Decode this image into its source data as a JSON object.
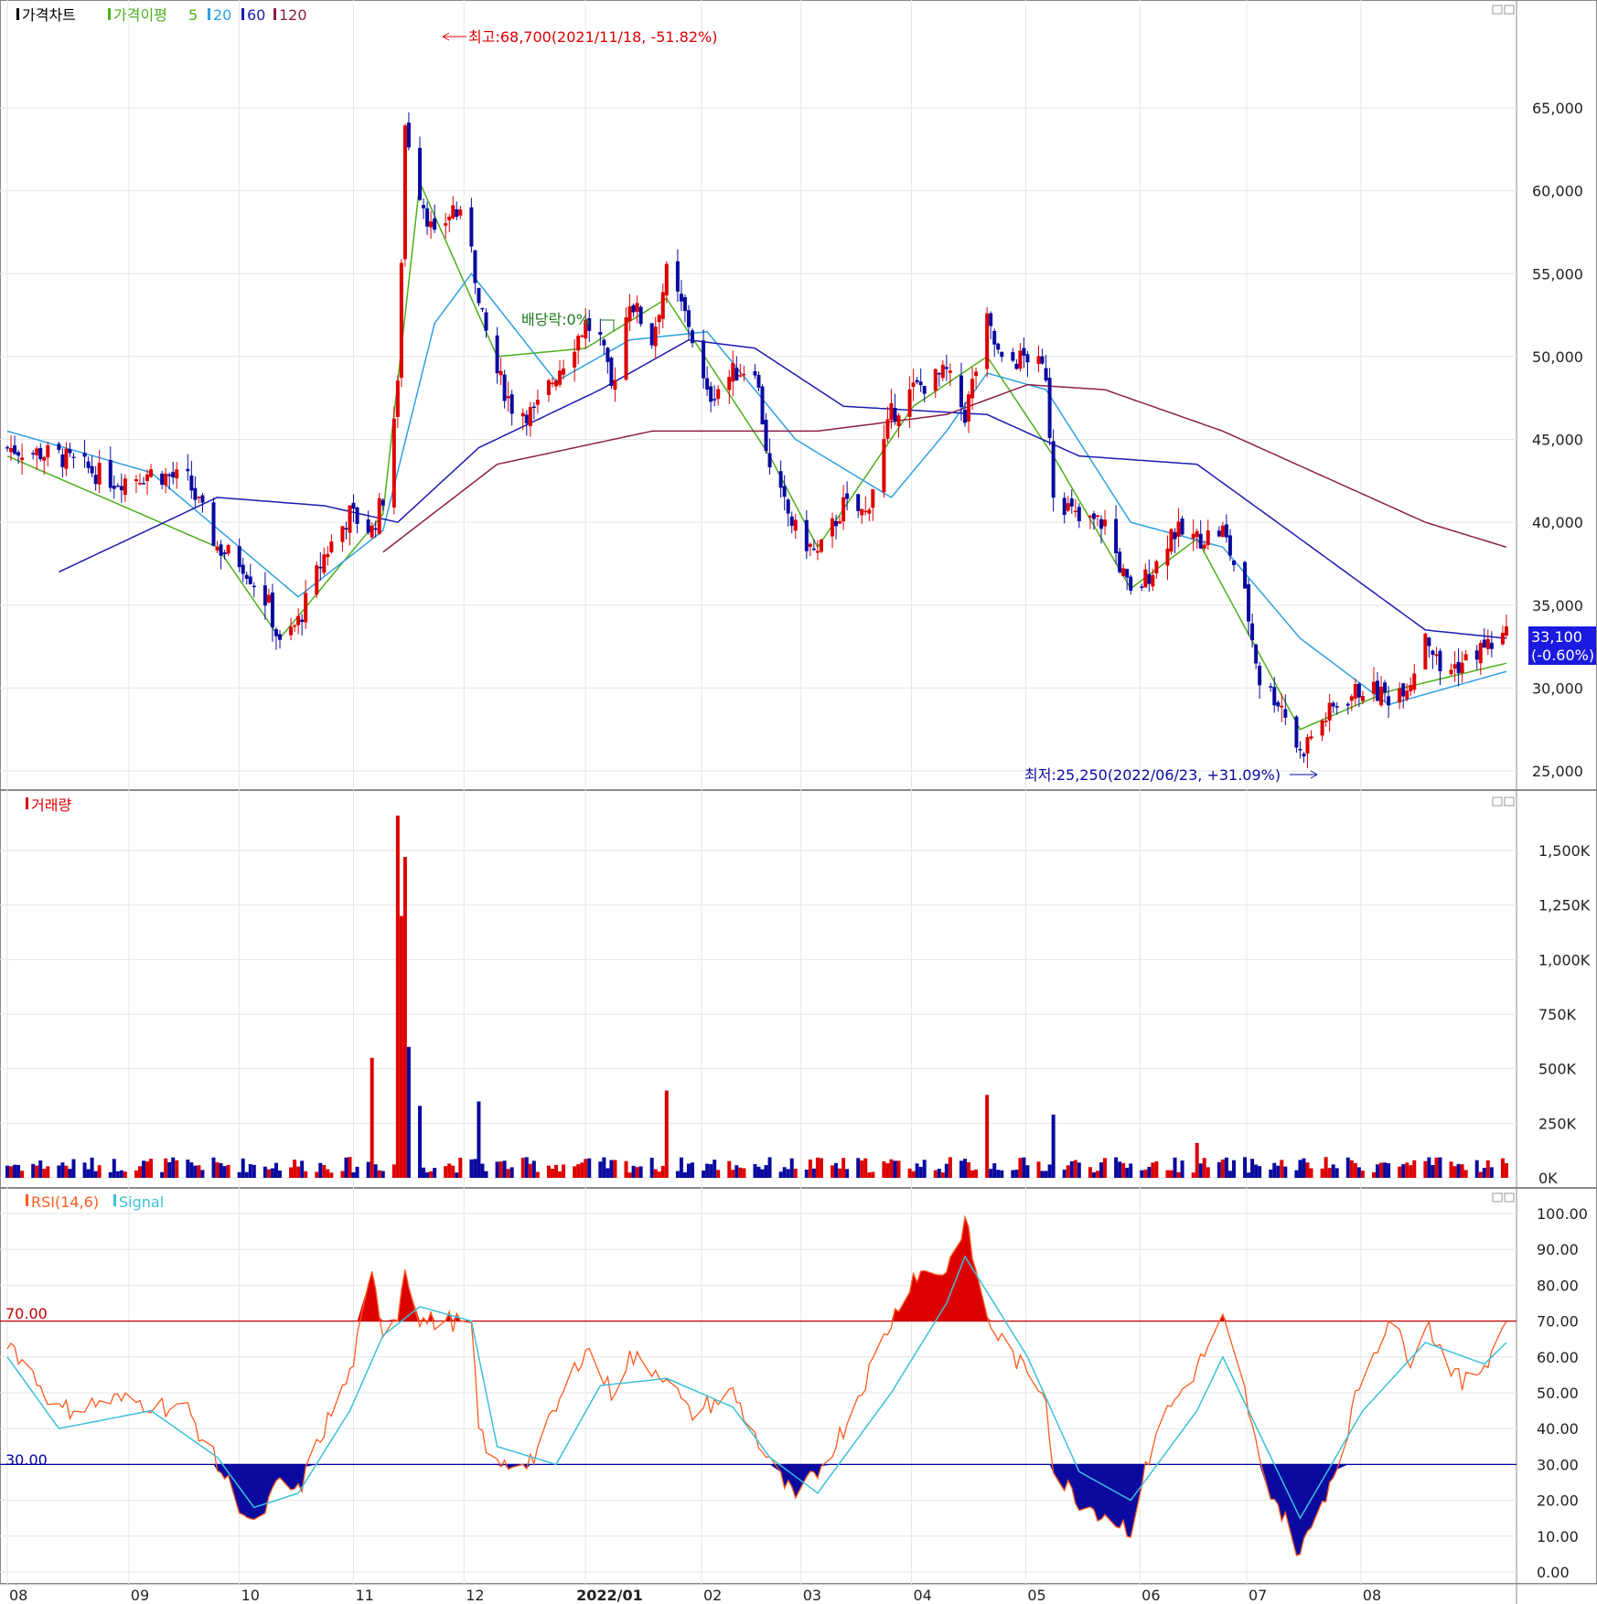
{
  "colors": {
    "up": "#dd0000",
    "down": "#0a0aa0",
    "ma5": "#4caf1a",
    "ma20": "#2fa0e0",
    "ma60": "#1a1ab0",
    "ma120": "#8a1f4a",
    "grid": "#e6e6e6",
    "rsi": "#ff5a1e",
    "signal": "#3cc0d8",
    "line70": "#c00000",
    "line30": "#0000a0"
  },
  "price_panel": {
    "legend": {
      "title": "가격차트",
      "ma_label": "가격이평",
      "ma5": "5",
      "ma20": "20",
      "ma60": "60",
      "ma120": "120"
    },
    "high_annotation": "최고:68,700(2021/11/18, -51.82%)",
    "low_annotation": "최저:25,250(2022/06/23, +31.09%)",
    "dividend_annotation": "배당락:0%",
    "current_price": "33,100",
    "current_change": "(-0.60%)",
    "y_ticks": [
      "65,000",
      "60,000",
      "55,000",
      "50,000",
      "45,000",
      "40,000",
      "35,000",
      "30,000",
      "25,000"
    ]
  },
  "volume_panel": {
    "legend": "거래량",
    "y_ticks": [
      "1,500K",
      "1,250K",
      "1,000K",
      "750K",
      "500K",
      "250K",
      "0K"
    ]
  },
  "rsi_panel": {
    "legend_rsi": "RSI(14,6)",
    "legend_signal": "Signal",
    "level_70_label": "70.00",
    "level_30_label": "30.00",
    "y_ticks": [
      "100.00",
      "90.00",
      "80.00",
      "70.00",
      "60.00",
      "50.00",
      "40.00",
      "30.00",
      "20.00",
      "10.00",
      "0.00"
    ]
  },
  "x_axis": {
    "labels": [
      "08",
      "09",
      "10",
      "11",
      "12",
      "2022/01",
      "02",
      "03",
      "04",
      "05",
      "06",
      "07",
      "08"
    ]
  },
  "chart_data": [
    {
      "type": "candlestick",
      "x_range": [
        "2021-08",
        "2022-08"
      ],
      "ylim": [
        24000,
        69500
      ],
      "grid": true,
      "price_path": [
        [
          "2021-08-02",
          44500
        ],
        [
          "2021-08-16",
          44000
        ],
        [
          "2021-08-31",
          42500
        ],
        [
          "2021-09-10",
          43000
        ],
        [
          "2021-09-20",
          42500
        ],
        [
          "2021-09-28",
          38500
        ],
        [
          "2021-10-05",
          37500
        ],
        [
          "2021-10-12",
          35000
        ],
        [
          "2021-10-15",
          32500
        ],
        [
          "2021-10-20",
          34000
        ],
        [
          "2021-10-27",
          38000
        ],
        [
          "2021-11-03",
          40500
        ],
        [
          "2021-11-09",
          39500
        ],
        [
          "2021-11-12",
          41500
        ],
        [
          "2021-11-16",
          48000
        ],
        [
          "2021-11-18",
          64000
        ],
        [
          "2021-11-22",
          60000
        ],
        [
          "2021-11-26",
          57000
        ],
        [
          "2021-12-01",
          59000
        ],
        [
          "2021-12-06",
          57000
        ],
        [
          "2021-12-08",
          53000
        ],
        [
          "2021-12-13",
          49000
        ],
        [
          "2021-12-17",
          47000
        ],
        [
          "2021-12-23",
          46500
        ],
        [
          "2021-12-29",
          49000
        ],
        [
          "2022-01-06",
          52000
        ],
        [
          "2022-01-10",
          51000
        ],
        [
          "2022-01-13",
          48000
        ],
        [
          "2022-01-18",
          53500
        ],
        [
          "2022-01-24",
          51000
        ],
        [
          "2022-01-28",
          55000
        ],
        [
          "2022-02-03",
          52000
        ],
        [
          "2022-02-08",
          47500
        ],
        [
          "2022-02-15",
          49000
        ],
        [
          "2022-02-21",
          49500
        ],
        [
          "2022-02-25",
          43000
        ],
        [
          "2022-03-04",
          39500
        ],
        [
          "2022-03-10",
          38000
        ],
        [
          "2022-03-17",
          41000
        ],
        [
          "2022-03-23",
          40500
        ],
        [
          "2022-03-30",
          46500
        ],
        [
          "2022-04-05",
          48000
        ],
        [
          "2022-04-14",
          49000
        ],
        [
          "2022-04-19",
          46500
        ],
        [
          "2022-04-25",
          52000
        ],
        [
          "2022-04-29",
          49500
        ],
        [
          "2022-05-06",
          50000
        ],
        [
          "2022-05-11",
          49000
        ],
        [
          "2022-05-13",
          42000
        ],
        [
          "2022-05-20",
          40000
        ],
        [
          "2022-05-27",
          40000
        ],
        [
          "2022-06-03",
          35500
        ],
        [
          "2022-06-10",
          37500
        ],
        [
          "2022-06-14",
          39500
        ],
        [
          "2022-06-21",
          39000
        ],
        [
          "2022-06-28",
          39500
        ],
        [
          "2022-07-04",
          35500
        ],
        [
          "2022-07-08",
          30500
        ],
        [
          "2022-07-14",
          29000
        ],
        [
          "2022-07-19",
          26000
        ],
        [
          "2022-07-23",
          27500
        ],
        [
          "2022-07-29",
          29000
        ],
        [
          "2022-08-05",
          30000
        ],
        [
          "2022-08-12",
          29500
        ],
        [
          "2022-08-18",
          30500
        ],
        [
          "2022-08-22",
          33500
        ],
        [
          "2022-08-26",
          31000
        ],
        [
          "2022-09-01",
          31500
        ],
        [
          "2022-09-07",
          32500
        ],
        [
          "2022-09-13",
          33100
        ]
      ],
      "ma": {
        "5": [
          [
            "2021-08-02",
            44000
          ],
          [
            "2021-09-28",
            38500
          ],
          [
            "2021-10-15",
            33000
          ],
          [
            "2021-11-12",
            40500
          ],
          [
            "2021-11-22",
            60500
          ],
          [
            "2021-12-13",
            50000
          ],
          [
            "2022-01-06",
            50500
          ],
          [
            "2022-01-28",
            53500
          ],
          [
            "2022-02-25",
            44000
          ],
          [
            "2022-03-10",
            38500
          ],
          [
            "2022-04-05",
            47000
          ],
          [
            "2022-04-25",
            50000
          ],
          [
            "2022-05-13",
            44000
          ],
          [
            "2022-06-03",
            36000
          ],
          [
            "2022-06-21",
            39000
          ],
          [
            "2022-07-19",
            27500
          ],
          [
            "2022-08-12",
            29800
          ],
          [
            "2022-09-13",
            31500
          ]
        ],
        "20": [
          [
            "2021-08-02",
            45500
          ],
          [
            "2021-09-10",
            43000
          ],
          [
            "2021-10-20",
            35500
          ],
          [
            "2021-11-12",
            39500
          ],
          [
            "2021-11-26",
            52000
          ],
          [
            "2021-12-06",
            55000
          ],
          [
            "2021-12-29",
            48500
          ],
          [
            "2022-01-18",
            51000
          ],
          [
            "2022-02-08",
            51500
          ],
          [
            "2022-03-04",
            45000
          ],
          [
            "2022-03-30",
            41500
          ],
          [
            "2022-04-14",
            45500
          ],
          [
            "2022-04-25",
            49000
          ],
          [
            "2022-05-11",
            48000
          ],
          [
            "2022-06-03",
            40000
          ],
          [
            "2022-06-28",
            38500
          ],
          [
            "2022-07-19",
            33000
          ],
          [
            "2022-08-12",
            29000
          ],
          [
            "2022-09-13",
            31000
          ]
        ],
        "60": [
          [
            "2021-08-16",
            37000
          ],
          [
            "2021-09-28",
            41500
          ],
          [
            "2021-10-27",
            41000
          ],
          [
            "2021-11-16",
            40000
          ],
          [
            "2021-12-08",
            44500
          ],
          [
            "2022-01-10",
            48000
          ],
          [
            "2022-02-03",
            51000
          ],
          [
            "2022-02-21",
            50500
          ],
          [
            "2022-03-17",
            47000
          ],
          [
            "2022-04-25",
            46500
          ],
          [
            "2022-05-20",
            44000
          ],
          [
            "2022-06-21",
            43500
          ],
          [
            "2022-07-19",
            39000
          ],
          [
            "2022-08-22",
            33500
          ],
          [
            "2022-09-13",
            33000
          ]
        ],
        "120": [
          [
            "2021-11-12",
            38200
          ],
          [
            "2021-12-13",
            43500
          ],
          [
            "2022-01-24",
            45500
          ],
          [
            "2022-03-10",
            45500
          ],
          [
            "2022-04-14",
            46500
          ],
          [
            "2022-05-06",
            48300
          ],
          [
            "2022-05-27",
            48000
          ],
          [
            "2022-06-28",
            45500
          ],
          [
            "2022-08-22",
            40000
          ],
          [
            "2022-09-13",
            38500
          ]
        ]
      }
    },
    {
      "type": "bar",
      "title": "거래량",
      "ylim": [
        0,
        1700000
      ],
      "spikes": [
        [
          "2021-11-09",
          550000
        ],
        [
          "2021-11-16",
          1660000
        ],
        [
          "2021-11-17",
          1200000
        ],
        [
          "2021-11-18",
          1470000
        ],
        [
          "2021-11-19",
          600000
        ],
        [
          "2021-11-22",
          330000
        ],
        [
          "2021-12-08",
          350000
        ],
        [
          "2022-01-28",
          400000
        ],
        [
          "2022-04-25",
          380000
        ],
        [
          "2022-05-13",
          290000
        ],
        [
          "2022-06-21",
          160000
        ]
      ],
      "baseline": 60000
    },
    {
      "type": "line",
      "title": "RSI(14,6)",
      "ylim": [
        0,
        100
      ],
      "levels": [
        70,
        30
      ],
      "rsi": [
        [
          "2021-08-02",
          65
        ],
        [
          "2021-08-16",
          45
        ],
        [
          "2021-08-31",
          48
        ],
        [
          "2021-09-10",
          47
        ],
        [
          "2021-09-20",
          45
        ],
        [
          "2021-09-28",
          30
        ],
        [
          "2021-10-08",
          12
        ],
        [
          "2021-10-15",
          25
        ],
        [
          "2021-10-20",
          22
        ],
        [
          "2021-10-27",
          40
        ],
        [
          "2021-11-03",
          55
        ],
        [
          "2021-11-09",
          82
        ],
        [
          "2021-11-12",
          68
        ],
        [
          "2021-11-16",
          72
        ],
        [
          "2021-11-18",
          86
        ],
        [
          "2021-11-22",
          70
        ],
        [
          "2021-12-01",
          70
        ],
        [
          "2021-12-06",
          68
        ],
        [
          "2021-12-08",
          40
        ],
        [
          "2021-12-13",
          29
        ],
        [
          "2021-12-23",
          32
        ],
        [
          "2022-01-06",
          63
        ],
        [
          "2022-01-13",
          50
        ],
        [
          "2022-01-18",
          60
        ],
        [
          "2022-01-28",
          55
        ],
        [
          "2022-02-03",
          44
        ],
        [
          "2022-02-15",
          50
        ],
        [
          "2022-02-25",
          30
        ],
        [
          "2022-03-04",
          20
        ],
        [
          "2022-03-10",
          28
        ],
        [
          "2022-03-17",
          40
        ],
        [
          "2022-03-30",
          70
        ],
        [
          "2022-04-05",
          83
        ],
        [
          "2022-04-14",
          84
        ],
        [
          "2022-04-19",
          98
        ],
        [
          "2022-04-25",
          70
        ],
        [
          "2022-05-06",
          55
        ],
        [
          "2022-05-11",
          50
        ],
        [
          "2022-05-13",
          28
        ],
        [
          "2022-05-20",
          20
        ],
        [
          "2022-06-03",
          12
        ],
        [
          "2022-06-10",
          40
        ],
        [
          "2022-06-21",
          57
        ],
        [
          "2022-06-28",
          70
        ],
        [
          "2022-07-04",
          50
        ],
        [
          "2022-07-08",
          30
        ],
        [
          "2022-07-19",
          5
        ],
        [
          "2022-07-29",
          30
        ],
        [
          "2022-08-05",
          55
        ],
        [
          "2022-08-12",
          70
        ],
        [
          "2022-08-18",
          60
        ],
        [
          "2022-08-22",
          70
        ],
        [
          "2022-09-01",
          52
        ],
        [
          "2022-09-07",
          58
        ],
        [
          "2022-09-13",
          70
        ]
      ],
      "signal": [
        [
          "2021-08-02",
          60
        ],
        [
          "2021-08-16",
          40
        ],
        [
          "2021-09-10",
          45
        ],
        [
          "2021-09-28",
          32
        ],
        [
          "2021-10-08",
          18
        ],
        [
          "2021-10-20",
          22
        ],
        [
          "2021-11-03",
          45
        ],
        [
          "2021-11-12",
          66
        ],
        [
          "2021-11-22",
          74
        ],
        [
          "2021-12-06",
          70
        ],
        [
          "2021-12-13",
          35
        ],
        [
          "2021-12-29",
          30
        ],
        [
          "2022-01-10",
          52
        ],
        [
          "2022-01-28",
          54
        ],
        [
          "2022-02-15",
          46
        ],
        [
          "2022-02-25",
          32
        ],
        [
          "2022-03-10",
          22
        ],
        [
          "2022-03-30",
          50
        ],
        [
          "2022-04-14",
          75
        ],
        [
          "2022-04-19",
          88
        ],
        [
          "2022-05-06",
          60
        ],
        [
          "2022-05-20",
          28
        ],
        [
          "2022-06-03",
          20
        ],
        [
          "2022-06-21",
          45
        ],
        [
          "2022-06-28",
          60
        ],
        [
          "2022-07-19",
          15
        ],
        [
          "2022-08-05",
          45
        ],
        [
          "2022-08-22",
          64
        ],
        [
          "2022-09-07",
          58
        ],
        [
          "2022-09-13",
          64
        ]
      ]
    }
  ]
}
